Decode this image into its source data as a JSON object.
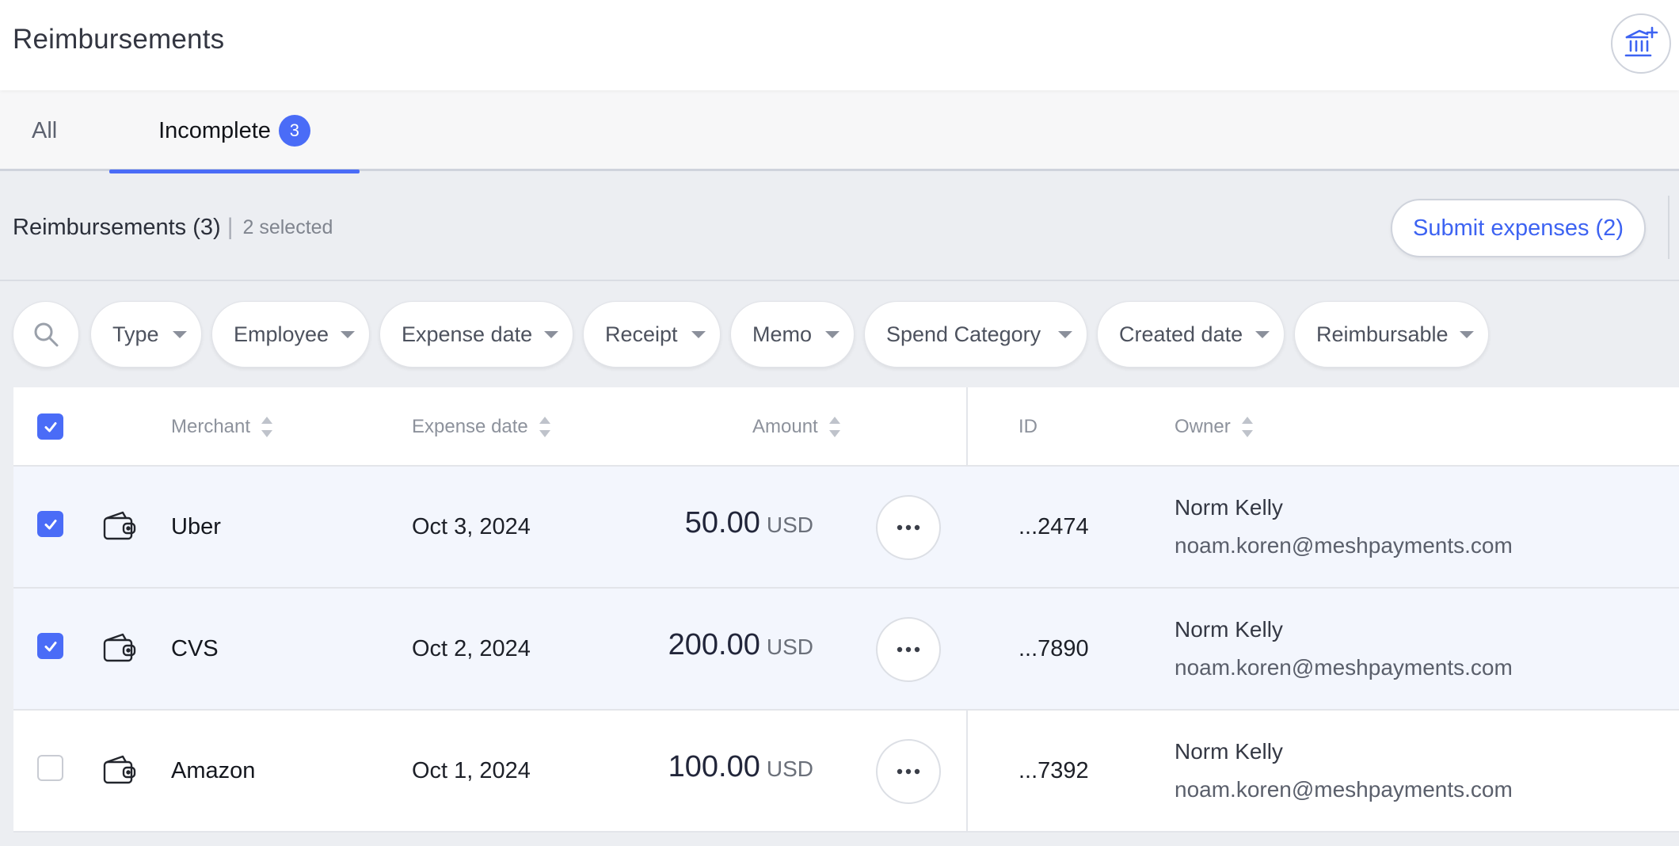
{
  "header": {
    "title": "Reimbursements",
    "action_icon": "bank-plus-icon"
  },
  "tabs": [
    {
      "label": "All",
      "active": false
    },
    {
      "label": "Incomplete",
      "badge": "3",
      "active": true
    }
  ],
  "toolbar": {
    "heading": "Reimbursements (3)",
    "separator": "|",
    "selected_text": "2 selected",
    "submit_label": "Submit expenses (2)"
  },
  "filters": {
    "search_icon": "search-icon",
    "chips": [
      "Type",
      "Employee",
      "Expense date",
      "Receipt",
      "Memo",
      "Spend Category",
      "Created date",
      "Reimbursable"
    ]
  },
  "table": {
    "columns": {
      "merchant": "Merchant",
      "expense_date": "Expense date",
      "amount": "Amount",
      "id": "ID",
      "owner": "Owner"
    },
    "select_all_checked": true,
    "rows": [
      {
        "checked": true,
        "icon": "wallet-icon",
        "merchant": "Uber",
        "date": "Oct 3, 2024",
        "amount": "50.00",
        "currency": "USD",
        "id": "...2474",
        "owner_name": "Norm Kelly",
        "owner_email": "noam.koren@meshpayments.com"
      },
      {
        "checked": true,
        "icon": "wallet-icon",
        "merchant": "CVS",
        "date": "Oct 2, 2024",
        "amount": "200.00",
        "currency": "USD",
        "id": "...7890",
        "owner_name": "Norm Kelly",
        "owner_email": "noam.koren@meshpayments.com"
      },
      {
        "checked": false,
        "icon": "wallet-icon",
        "merchant": "Amazon",
        "date": "Oct 1, 2024",
        "amount": "100.00",
        "currency": "USD",
        "id": "...7392",
        "owner_name": "Norm Kelly",
        "owner_email": "noam.koren@meshpayments.com"
      }
    ]
  },
  "colors": {
    "accent": "#4a6cf7",
    "link": "#3d63f2",
    "selected_row": "#f3f6fd"
  }
}
